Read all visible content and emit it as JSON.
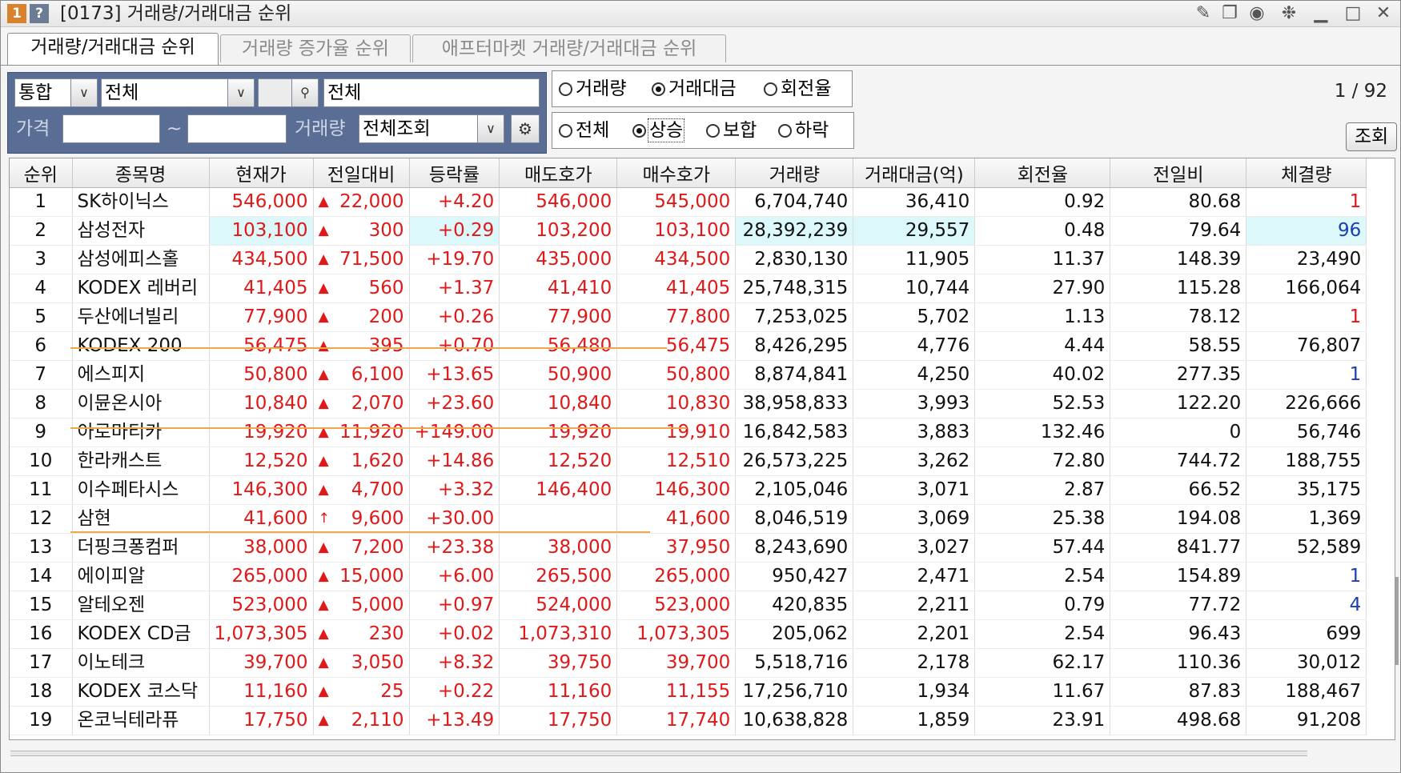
{
  "window": {
    "badge1": "1",
    "badge2": "?",
    "title": "[0173] 거래량/거래대금 순위",
    "icons": [
      "memo-icon",
      "copy-window-icon",
      "camera-icon",
      "gear-icon",
      "minimize-icon",
      "maximize-icon",
      "close-icon"
    ]
  },
  "tabs": [
    {
      "label": "거래량/거래대금 순위",
      "active": true
    },
    {
      "label": "거래량 증가율 순위",
      "active": false
    },
    {
      "label": "애프터마켓 거래량/거래대금 순위",
      "active": false
    }
  ],
  "filters": {
    "market_value": "통합",
    "scope_value": "전체",
    "code_value": "",
    "name_value": "전체",
    "price_label": "가격",
    "price_from": "",
    "tilde": "~",
    "price_to": "",
    "volume_label": "거래량",
    "volume_value": "전체조회"
  },
  "sort_radio": {
    "options": [
      {
        "label": "거래량",
        "selected": false
      },
      {
        "label": "거래대금",
        "selected": true
      },
      {
        "label": "회전율",
        "selected": false
      }
    ]
  },
  "trend_radio": {
    "options": [
      {
        "label": "전체",
        "selected": false
      },
      {
        "label": "상승",
        "selected": true
      },
      {
        "label": "보합",
        "selected": false
      },
      {
        "label": "하락",
        "selected": false
      }
    ]
  },
  "pager": "1 / 92",
  "query_button": "조회",
  "colors": {
    "up": "#e01818",
    "down_blue": "#1a3fb0",
    "highlight": "#dcf8fb",
    "underline": "#f0a64a",
    "panel": "#5a6e95"
  },
  "table": {
    "columns": [
      "순위",
      "종목명",
      "현재가",
      "전일대비",
      "등락률",
      "매도호가",
      "매수호가",
      "거래량",
      "거래대금(억)",
      "회전율",
      "전일비",
      "체결량"
    ],
    "rows": [
      {
        "rank": "1",
        "name": "SK하이닉스",
        "price": "546,000",
        "sign": "▲",
        "change": "22,000",
        "rate": "+4.20",
        "ask": "546,000",
        "bid": "545,000",
        "volume": "6,704,740",
        "amount": "36,410",
        "turnover": "0.92",
        "prev_ratio": "80.68",
        "exec": "1",
        "exec_color": "red"
      },
      {
        "rank": "2",
        "name": "삼성전자",
        "price": "103,100",
        "sign": "▲",
        "change": "300",
        "rate": "+0.29",
        "ask": "103,200",
        "bid": "103,100",
        "volume": "28,392,239",
        "amount": "29,557",
        "turnover": "0.48",
        "prev_ratio": "79.64",
        "exec": "96",
        "exec_color": "blue",
        "highlight": true
      },
      {
        "rank": "3",
        "name": "삼성에피스홀",
        "price": "434,500",
        "sign": "▲",
        "change": "71,500",
        "rate": "+19.70",
        "ask": "435,000",
        "bid": "434,500",
        "volume": "2,830,130",
        "amount": "11,905",
        "turnover": "11.37",
        "prev_ratio": "148.39",
        "exec": "23,490",
        "exec_color": "black"
      },
      {
        "rank": "4",
        "name": "KODEX 레버리",
        "price": "41,405",
        "sign": "▲",
        "change": "560",
        "rate": "+1.37",
        "ask": "41,410",
        "bid": "41,405",
        "volume": "25,748,315",
        "amount": "10,744",
        "turnover": "27.90",
        "prev_ratio": "115.28",
        "exec": "166,064",
        "exec_color": "black"
      },
      {
        "rank": "5",
        "name": "두산에너빌리",
        "price": "77,900",
        "sign": "▲",
        "change": "200",
        "rate": "+0.26",
        "ask": "77,900",
        "bid": "77,800",
        "volume": "7,253,025",
        "amount": "5,702",
        "turnover": "1.13",
        "prev_ratio": "78.12",
        "exec": "1",
        "exec_color": "red"
      },
      {
        "rank": "6",
        "name": "KODEX 200",
        "price": "56,475",
        "sign": "▲",
        "change": "395",
        "rate": "+0.70",
        "ask": "56,480",
        "bid": "56,475",
        "volume": "8,426,295",
        "amount": "4,776",
        "turnover": "4.44",
        "prev_ratio": "58.55",
        "exec": "76,807",
        "exec_color": "black"
      },
      {
        "rank": "7",
        "name": "에스피지",
        "price": "50,800",
        "sign": "▲",
        "change": "6,100",
        "rate": "+13.65",
        "ask": "50,900",
        "bid": "50,800",
        "volume": "8,874,841",
        "amount": "4,250",
        "turnover": "40.02",
        "prev_ratio": "277.35",
        "exec": "1",
        "exec_color": "blue"
      },
      {
        "rank": "8",
        "name": "이뮨온시아",
        "price": "10,840",
        "sign": "▲",
        "change": "2,070",
        "rate": "+23.60",
        "ask": "10,840",
        "bid": "10,830",
        "volume": "38,958,833",
        "amount": "3,993",
        "turnover": "52.53",
        "prev_ratio": "122.20",
        "exec": "226,666",
        "exec_color": "black"
      },
      {
        "rank": "9",
        "name": "아로마티카",
        "price": "19,920",
        "sign": "▲",
        "change": "11,920",
        "rate": "+149.00",
        "ask": "19,920",
        "bid": "19,910",
        "volume": "16,842,583",
        "amount": "3,883",
        "turnover": "132.46",
        "prev_ratio": "0",
        "exec": "56,746",
        "exec_color": "black"
      },
      {
        "rank": "10",
        "name": "한라캐스트",
        "price": "12,520",
        "sign": "▲",
        "change": "1,620",
        "rate": "+14.86",
        "ask": "12,520",
        "bid": "12,510",
        "volume": "26,573,225",
        "amount": "3,262",
        "turnover": "72.80",
        "prev_ratio": "744.72",
        "exec": "188,755",
        "exec_color": "black"
      },
      {
        "rank": "11",
        "name": "이수페타시스",
        "price": "146,300",
        "sign": "▲",
        "change": "4,700",
        "rate": "+3.32",
        "ask": "146,400",
        "bid": "146,300",
        "volume": "2,105,046",
        "amount": "3,071",
        "turnover": "2.87",
        "prev_ratio": "66.52",
        "exec": "35,175",
        "exec_color": "black"
      },
      {
        "rank": "12",
        "name": "삼현",
        "price": "41,600",
        "sign": "↑",
        "change": "9,600",
        "rate": "+30.00",
        "ask": "",
        "bid": "41,600",
        "volume": "8,046,519",
        "amount": "3,069",
        "turnover": "25.38",
        "prev_ratio": "194.08",
        "exec": "1,369",
        "exec_color": "black"
      },
      {
        "rank": "13",
        "name": "더핑크퐁컴퍼",
        "price": "38,000",
        "sign": "▲",
        "change": "7,200",
        "rate": "+23.38",
        "ask": "38,000",
        "bid": "37,950",
        "volume": "8,243,690",
        "amount": "3,027",
        "turnover": "57.44",
        "prev_ratio": "841.77",
        "exec": "52,589",
        "exec_color": "black"
      },
      {
        "rank": "14",
        "name": "에이피알",
        "price": "265,000",
        "sign": "▲",
        "change": "15,000",
        "rate": "+6.00",
        "ask": "265,500",
        "bid": "265,000",
        "volume": "950,427",
        "amount": "2,471",
        "turnover": "2.54",
        "prev_ratio": "154.89",
        "exec": "1",
        "exec_color": "blue"
      },
      {
        "rank": "15",
        "name": "알테오젠",
        "price": "523,000",
        "sign": "▲",
        "change": "5,000",
        "rate": "+0.97",
        "ask": "524,000",
        "bid": "523,000",
        "volume": "420,835",
        "amount": "2,211",
        "turnover": "0.79",
        "prev_ratio": "77.72",
        "exec": "4",
        "exec_color": "blue"
      },
      {
        "rank": "16",
        "name": "KODEX CD금",
        "price": "1,073,305",
        "sign": "▲",
        "change": "230",
        "rate": "+0.02",
        "ask": "1,073,310",
        "bid": "1,073,305",
        "volume": "205,062",
        "amount": "2,201",
        "turnover": "2.54",
        "prev_ratio": "96.43",
        "exec": "699",
        "exec_color": "black"
      },
      {
        "rank": "17",
        "name": "이노테크",
        "price": "39,700",
        "sign": "▲",
        "change": "3,050",
        "rate": "+8.32",
        "ask": "39,750",
        "bid": "39,700",
        "volume": "5,518,716",
        "amount": "2,178",
        "turnover": "62.17",
        "prev_ratio": "110.36",
        "exec": "30,012",
        "exec_color": "black"
      },
      {
        "rank": "18",
        "name": "KODEX 코스닥",
        "price": "11,160",
        "sign": "▲",
        "change": "25",
        "rate": "+0.22",
        "ask": "11,160",
        "bid": "11,155",
        "volume": "17,256,710",
        "amount": "1,934",
        "turnover": "11.67",
        "prev_ratio": "87.83",
        "exec": "188,467",
        "exec_color": "black"
      },
      {
        "rank": "19",
        "name": "온코닉테라퓨",
        "price": "17,750",
        "sign": "▲",
        "change": "2,110",
        "rate": "+13.49",
        "ask": "17,750",
        "bid": "17,740",
        "volume": "10,638,828",
        "amount": "1,859",
        "turnover": "23.91",
        "prev_ratio": "498.68",
        "exec": "91,208",
        "exec_color": "black"
      }
    ]
  }
}
